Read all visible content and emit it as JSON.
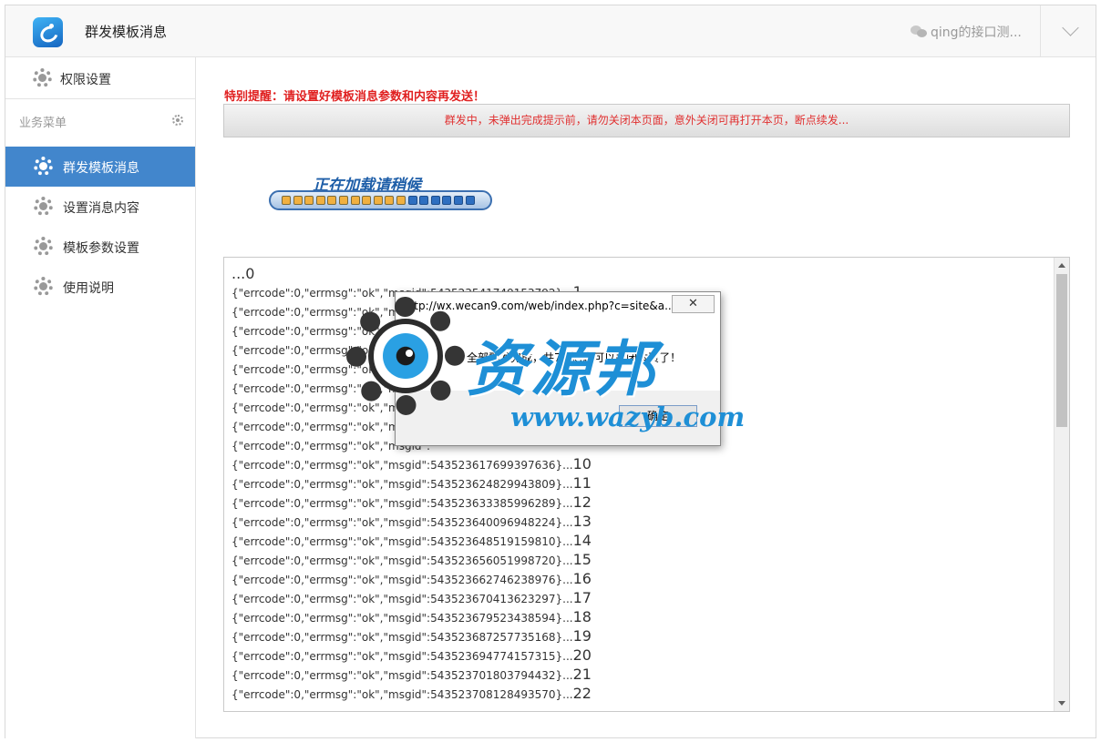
{
  "header": {
    "page_title": "群发模板消息",
    "account_name": "qing的接口测..."
  },
  "sidebar": {
    "top_item": "权限设置",
    "group_title": "业务菜单",
    "items": [
      {
        "label": "群发模板消息",
        "active": true
      },
      {
        "label": "设置消息内容",
        "active": false
      },
      {
        "label": "模板参数设置",
        "active": false
      },
      {
        "label": "使用说明",
        "active": false
      }
    ]
  },
  "main": {
    "warning": "特别提醒：请设置好模板消息参数和内容再发送！",
    "status": "群发中，未弹出完成提示前，请勿关闭本页面，意外关闭可再打开本页，断点续发...",
    "loader_text": "正在加载请稍候",
    "log_first": "...0",
    "log_lines": [
      {
        "text": "{\"errcode\":0,\"errmsg\":\"ok\",\"msgid\":543523541749153792}...",
        "n": "1"
      },
      {
        "text": "{\"errcode\":0,\"errmsg\":\"ok\",\"msgid\":",
        "n": ""
      },
      {
        "text": "{\"errcode\":0,\"errmsg\":\"ok\",\"msgid\":",
        "n": ""
      },
      {
        "text": "{\"errcode\":0,\"errmsg\":\"ok\",\"msgid\":",
        "n": ""
      },
      {
        "text": "{\"errcode\":0,\"errmsg\":\"ok\",\"msgid\":",
        "n": ""
      },
      {
        "text": "{\"errcode\":0,\"errmsg\":\"ok\",\"msgid\":",
        "n": ""
      },
      {
        "text": "{\"errcode\":0,\"errmsg\":\"ok\",\"msgid\":",
        "n": ""
      },
      {
        "text": "{\"errcode\":0,\"errmsg\":\"ok\",\"msgid\":",
        "n": ""
      },
      {
        "text": "{\"errcode\":0,\"errmsg\":\"ok\",\"msgid\":",
        "n": ""
      },
      {
        "text": "{\"errcode\":0,\"errmsg\":\"ok\",\"msgid\":543523617699397636}...",
        "n": "10"
      },
      {
        "text": "{\"errcode\":0,\"errmsg\":\"ok\",\"msgid\":543523624829943809}...",
        "n": "11"
      },
      {
        "text": "{\"errcode\":0,\"errmsg\":\"ok\",\"msgid\":543523633385996289}...",
        "n": "12"
      },
      {
        "text": "{\"errcode\":0,\"errmsg\":\"ok\",\"msgid\":543523640096948224}...",
        "n": "13"
      },
      {
        "text": "{\"errcode\":0,\"errmsg\":\"ok\",\"msgid\":543523648519159810}...",
        "n": "14"
      },
      {
        "text": "{\"errcode\":0,\"errmsg\":\"ok\",\"msgid\":543523656051998720}...",
        "n": "15"
      },
      {
        "text": "{\"errcode\":0,\"errmsg\":\"ok\",\"msgid\":543523662746238976}...",
        "n": "16"
      },
      {
        "text": "{\"errcode\":0,\"errmsg\":\"ok\",\"msgid\":543523670413623297}...",
        "n": "17"
      },
      {
        "text": "{\"errcode\":0,\"errmsg\":\"ok\",\"msgid\":543523679523438594}...",
        "n": "18"
      },
      {
        "text": "{\"errcode\":0,\"errmsg\":\"ok\",\"msgid\":543523687257735168}...",
        "n": "19"
      },
      {
        "text": "{\"errcode\":0,\"errmsg\":\"ok\",\"msgid\":543523694774157315}...",
        "n": "20"
      },
      {
        "text": "{\"errcode\":0,\"errmsg\":\"ok\",\"msgid\":543523701803794432}...",
        "n": "21"
      },
      {
        "text": "{\"errcode\":0,\"errmsg\":\"ok\",\"msgid\":543523708128493570}...",
        "n": "22"
      }
    ]
  },
  "dialog": {
    "url": "http://wx.wecan9.com/web/index.php?c=site&a...",
    "close": "✕",
    "message": "全部群发完成，共74条,您可以关闭本页了！",
    "ok": "确定"
  },
  "watermark": {
    "title": "资源邦",
    "url": "www.wazyb.com"
  },
  "colors": {
    "accent": "#4286cc",
    "warning": "#e02020",
    "watermark": "#1e8fd6"
  },
  "icons": {
    "menu": "gear-icon",
    "account": "wechat-icon",
    "expand": "chevron-down-icon"
  }
}
